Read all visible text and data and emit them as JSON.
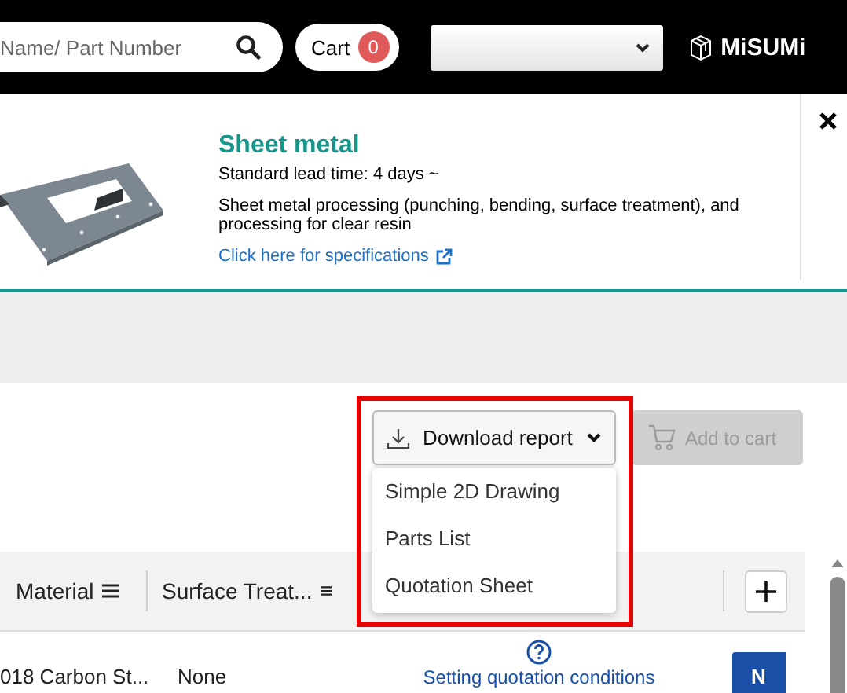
{
  "header": {
    "search": {
      "placeholder": "Name/ Part Number"
    },
    "cart": {
      "label": "Cart",
      "count": "0"
    },
    "logo": "MiSUMi"
  },
  "banner": {
    "title": "Sheet metal",
    "lead_time": "Standard lead time: 4 days ~",
    "description": "Sheet metal processing (punching, bending, surface treatment), and processing for clear resin",
    "link": "Click here for specifications"
  },
  "actions": {
    "download": {
      "label": "Download report",
      "expanded": true,
      "menu": [
        "Simple 2D Drawing",
        "Parts List",
        "Quotation Sheet"
      ]
    },
    "add_to_cart": {
      "label": "Add to cart",
      "disabled": true
    },
    "highlighted": true
  },
  "table": {
    "columns": [
      "Material",
      "Surface Treat..."
    ],
    "rows": [
      {
        "cells": [
          "018 Carbon St...",
          "None"
        ],
        "link": "Setting quotation conditions",
        "button": "N"
      }
    ]
  }
}
